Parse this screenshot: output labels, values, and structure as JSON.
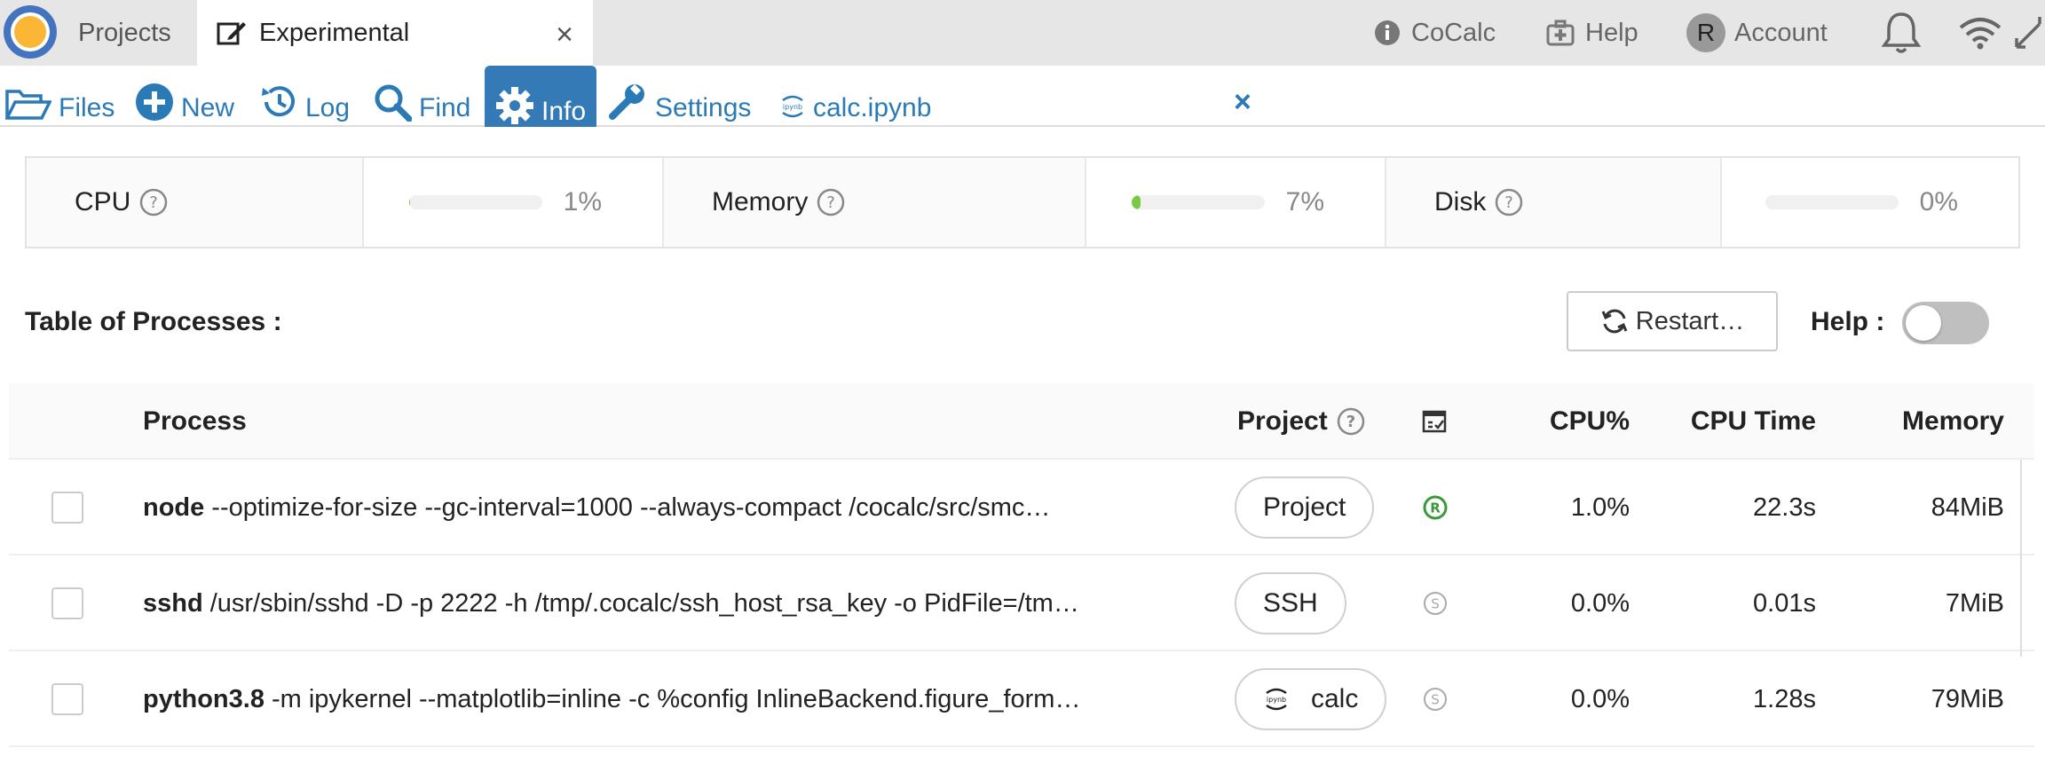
{
  "topbar": {
    "projects_label": "Projects",
    "active_tab_label": "Experimental",
    "close_glyph": "×",
    "cocalc_label": "CoCalc",
    "help_label": "Help",
    "account_label": "Account",
    "account_avatar": "R"
  },
  "filebar": {
    "files": "Files",
    "new": "New",
    "log": "Log",
    "find": "Find",
    "info": "Info",
    "settings": "Settings",
    "file_tab": "calc.ipynb",
    "close_glyph": "×"
  },
  "stats": {
    "cpu": {
      "label": "CPU",
      "value": "1%",
      "fraction": 0.01
    },
    "memory": {
      "label": "Memory",
      "value": "7%",
      "fraction": 0.07
    },
    "disk": {
      "label": "Disk",
      "value": "0%",
      "fraction": 0.0
    }
  },
  "processes": {
    "title": "Table of Processes",
    "restart_label": "Restart…",
    "help_label": "Help",
    "help_toggle_on": false,
    "columns": {
      "process": "Process",
      "project": "Project",
      "cpu_pct": "CPU%",
      "cpu_time": "CPU Time",
      "memory": "Memory"
    },
    "rows": [
      {
        "name": "node",
        "args": "--optimize-for-size --gc-interval=1000 --always-compact /cocalc/src/smc…",
        "type": "Project",
        "type_icon": "",
        "signal_icon": "registered-icon",
        "signal_color": "#3a9a3a",
        "cpu_pct": "1.0%",
        "cpu_time": "22.3s",
        "memory": "84MiB"
      },
      {
        "name": "sshd",
        "args": "/usr/sbin/sshd -D -p 2222 -h /tmp/.cocalc/ssh_host_rsa_key -o PidFile=/tm…",
        "type": "SSH",
        "type_icon": "",
        "signal_icon": "s-circle-icon",
        "signal_color": "#aaaaaa",
        "cpu_pct": "0.0%",
        "cpu_time": "0.01s",
        "memory": "7MiB"
      },
      {
        "name": "python3.8",
        "args": "-m ipykernel --matplotlib=inline -c %config InlineBackend.figure_form…",
        "type": "calc",
        "type_icon": "ipynb-icon",
        "signal_icon": "s-circle-icon",
        "signal_color": "#aaaaaa",
        "cpu_pct": "0.0%",
        "cpu_time": "1.28s",
        "memory": "79MiB"
      }
    ]
  }
}
